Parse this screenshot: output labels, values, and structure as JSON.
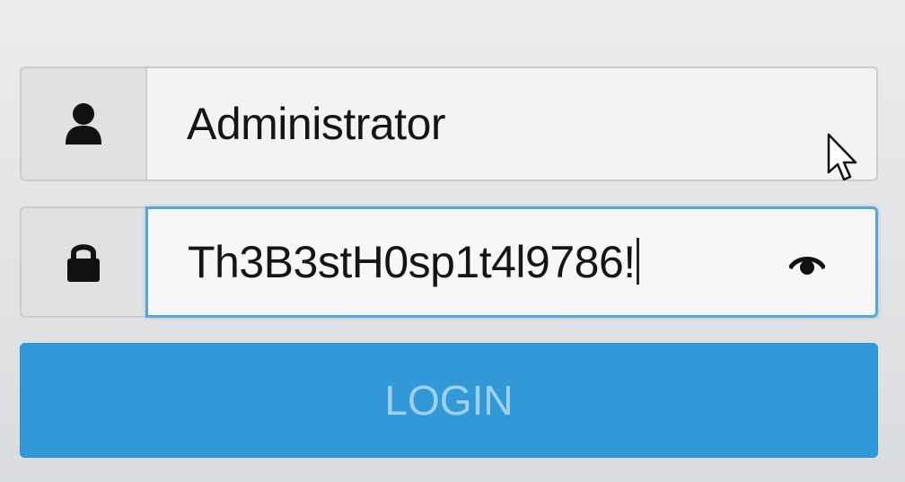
{
  "login_form": {
    "username": {
      "value": "Administrator",
      "icon": "user-icon"
    },
    "password": {
      "value": "Th3B3stH0sp1t4l9786!",
      "icon": "lock-icon",
      "toggle_icon": "eye-icon"
    },
    "login_button": {
      "label": "LOGIN"
    }
  },
  "colors": {
    "primary_button": "#3398d8",
    "button_text": "#9fd0ee",
    "focus_border": "#5aa3d6"
  }
}
